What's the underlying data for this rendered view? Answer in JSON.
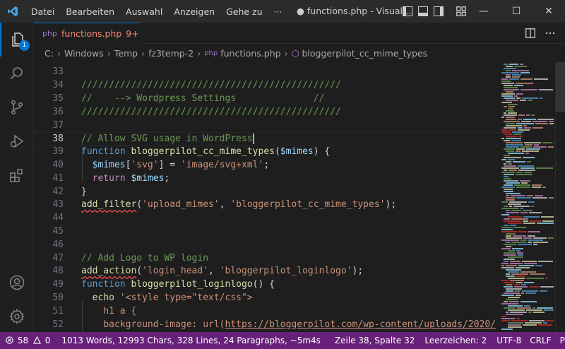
{
  "titlebar": {
    "menu": [
      "Datei",
      "Bearbeiten",
      "Auswahl",
      "Anzeigen",
      "Gehe zu"
    ],
    "more": "···",
    "title": "● functions.php - Visual ...",
    "minimize": "—",
    "maximize": "☐",
    "close": "✕"
  },
  "activity": {
    "explorer_badge": "1"
  },
  "tab": {
    "lang": "php",
    "filename": "functions.php",
    "problems": "9+"
  },
  "breadcrumb": [
    "C:",
    "Windows",
    "Temp",
    "fz3temp-2",
    "functions.php",
    "bloggerpilot_cc_mime_types"
  ],
  "editor": {
    "line_numbers": [
      "33",
      "34",
      "35",
      "36",
      "37",
      "38",
      "39",
      "40",
      "41",
      "42",
      "43",
      "44",
      "45",
      "46",
      "47",
      "48",
      "49",
      "50",
      "51",
      "52"
    ],
    "active_line": "38",
    "lines": {
      "l34": "///////////////////////////////////////////////",
      "l35": "//    --> Wordpress Settings              //",
      "l36": "///////////////////////////////////////////////",
      "l38": "// Allow SVG usage in WordPress",
      "l39_kw": "function",
      "l39_fn": "bloggerpilot_cc_mime_types",
      "l39_p1": "(",
      "l39_var": "$mimes",
      "l39_p2": ") {",
      "l40_var": "$mimes",
      "l40_p1": "[",
      "l40_s1": "'svg'",
      "l40_p2": "] = ",
      "l40_s2": "'image/svg+xml'",
      "l40_p3": ";",
      "l41_kw": "return",
      "l41_var": "$mimes",
      "l41_p": ";",
      "l42": "}",
      "l43_fn": "add_filter",
      "l43_p1": "(",
      "l43_s1": "'upload_mimes'",
      "l43_p2": ", ",
      "l43_s2": "'bloggerpilot_cc_mime_types'",
      "l43_p3": ");",
      "l47": "// Add Logo to WP login",
      "l48_fn": "add_action",
      "l48_p1": "(",
      "l48_s1": "'login_head'",
      "l48_p2": ", ",
      "l48_s2": "'bloggerpilot_loginlogo'",
      "l48_p3": ");",
      "l49_kw": "function",
      "l49_fn": "bloggerpilot_loginlogo",
      "l49_p": "() {",
      "l50_kw": "echo",
      "l50_s": "'<style type=\"text/css\">",
      "l51": "h1 a {",
      "l52_a": "background-image: url(",
      "l52_b": "https://bloggerpilot.com/wp-content/uploads/2020/"
    }
  },
  "status": {
    "errors": "58",
    "warnings": "0",
    "words": "1013 Words, 12993 Chars, 328 Lines, 24 Paragraphs, ~5m4s",
    "position": "Zeile 38, Spalte 32",
    "indent": "Leerzeichen: 2",
    "encoding": "UTF-8",
    "eol": "CRLF",
    "language": "PHP"
  },
  "colors": {
    "status_bar": "#68217a",
    "accent": "#0078d4",
    "editor_bg": "#1e1e1e"
  }
}
